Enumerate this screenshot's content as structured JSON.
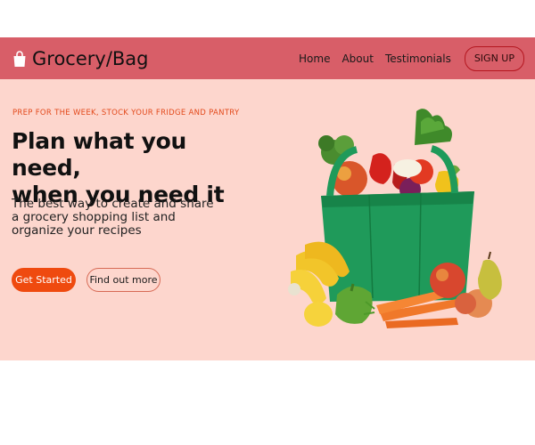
{
  "brand": {
    "name": "Grocery/Bag",
    "icon": "shopping-bag-icon"
  },
  "nav": {
    "links": [
      "Home",
      "About",
      "Testimonials"
    ],
    "signup_label": "SIGN UP"
  },
  "hero": {
    "eyebrow": "PREP FOR THE WEEK, STOCK YOUR FRIDGE AND PANTRY",
    "headline_line1": "Plan what you need,",
    "headline_line2": "when you need it",
    "subtext": "The best way to create and share a grocery shopping list and organize your recipes",
    "primary_button": "Get Started",
    "secondary_button": "Find out more",
    "image": "grocery-bag-illustration"
  },
  "colors": {
    "navbar": "#d85e68",
    "hero_bg": "#fdd6cd",
    "accent": "#ef4a0f",
    "eyebrow": "#e34a1c"
  }
}
